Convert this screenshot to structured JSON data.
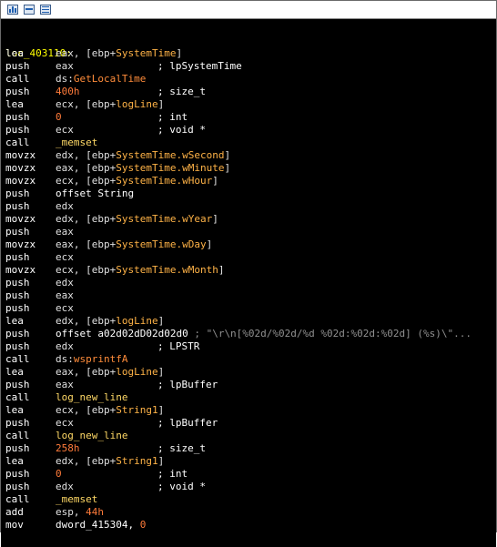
{
  "toolbar": {
    "buttons": [
      "graph-view-icon",
      "proximity-view-icon",
      "text-view-icon"
    ]
  },
  "code": {
    "label": "loc_403110:",
    "lines": [
      {
        "m": "lea",
        "t": [
          {
            "s": "eax, [ebp+",
            "c": "reg"
          },
          {
            "s": "SystemTime",
            "c": "var"
          },
          {
            "s": "]",
            "c": "reg"
          }
        ],
        "k": ""
      },
      {
        "m": "push",
        "t": [
          {
            "s": "eax",
            "c": "reg"
          }
        ],
        "k": "; lpSystemTime"
      },
      {
        "m": "call",
        "t": [
          {
            "s": "ds:",
            "c": "reg"
          },
          {
            "s": "GetLocalTime",
            "c": "fn"
          }
        ],
        "k": ""
      },
      {
        "m": "push",
        "t": [
          {
            "s": "400h",
            "c": "num"
          }
        ],
        "k": "; size_t"
      },
      {
        "m": "lea",
        "t": [
          {
            "s": "ecx, [ebp+",
            "c": "reg"
          },
          {
            "s": "logLine",
            "c": "var"
          },
          {
            "s": "]",
            "c": "reg"
          }
        ],
        "k": ""
      },
      {
        "m": "push",
        "t": [
          {
            "s": "0",
            "c": "num"
          }
        ],
        "k": "; int"
      },
      {
        "m": "push",
        "t": [
          {
            "s": "ecx",
            "c": "reg"
          }
        ],
        "k": "; void *"
      },
      {
        "m": "call",
        "t": [
          {
            "s": "_memset",
            "c": "sub"
          }
        ],
        "k": ""
      },
      {
        "m": "movzx",
        "t": [
          {
            "s": "edx, [ebp+",
            "c": "reg"
          },
          {
            "s": "SystemTime.wSecond",
            "c": "var"
          },
          {
            "s": "]",
            "c": "reg"
          }
        ],
        "k": ""
      },
      {
        "m": "movzx",
        "t": [
          {
            "s": "eax, [ebp+",
            "c": "reg"
          },
          {
            "s": "SystemTime.wMinute",
            "c": "var"
          },
          {
            "s": "]",
            "c": "reg"
          }
        ],
        "k": ""
      },
      {
        "m": "movzx",
        "t": [
          {
            "s": "ecx, [ebp+",
            "c": "reg"
          },
          {
            "s": "SystemTime.wHour",
            "c": "var"
          },
          {
            "s": "]",
            "c": "reg"
          }
        ],
        "k": ""
      },
      {
        "m": "push",
        "t": [
          {
            "s": "offset String",
            "c": "plain"
          }
        ],
        "k": ""
      },
      {
        "m": "push",
        "t": [
          {
            "s": "edx",
            "c": "reg"
          }
        ],
        "k": ""
      },
      {
        "m": "movzx",
        "t": [
          {
            "s": "edx, [ebp+",
            "c": "reg"
          },
          {
            "s": "SystemTime.wYear",
            "c": "var"
          },
          {
            "s": "]",
            "c": "reg"
          }
        ],
        "k": ""
      },
      {
        "m": "push",
        "t": [
          {
            "s": "eax",
            "c": "reg"
          }
        ],
        "k": ""
      },
      {
        "m": "movzx",
        "t": [
          {
            "s": "eax, [ebp+",
            "c": "reg"
          },
          {
            "s": "SystemTime.wDay",
            "c": "var"
          },
          {
            "s": "]",
            "c": "reg"
          }
        ],
        "k": ""
      },
      {
        "m": "push",
        "t": [
          {
            "s": "ecx",
            "c": "reg"
          }
        ],
        "k": ""
      },
      {
        "m": "movzx",
        "t": [
          {
            "s": "ecx, [ebp+",
            "c": "reg"
          },
          {
            "s": "SystemTime.wMonth",
            "c": "var"
          },
          {
            "s": "]",
            "c": "reg"
          }
        ],
        "k": ""
      },
      {
        "m": "push",
        "t": [
          {
            "s": "edx",
            "c": "reg"
          }
        ],
        "k": ""
      },
      {
        "m": "push",
        "t": [
          {
            "s": "eax",
            "c": "reg"
          }
        ],
        "k": ""
      },
      {
        "m": "push",
        "t": [
          {
            "s": "ecx",
            "c": "reg"
          }
        ],
        "k": ""
      },
      {
        "m": "lea",
        "t": [
          {
            "s": "edx, [ebp+",
            "c": "reg"
          },
          {
            "s": "logLine",
            "c": "var"
          },
          {
            "s": "]",
            "c": "reg"
          }
        ],
        "k": ""
      },
      {
        "m": "push",
        "t": [
          {
            "s": "offset a02d02dD02d02d0",
            "c": "plain"
          },
          {
            "s": " ; \"\\r\\n[%02d/%02d/%d %02d:%02d:%02d] (%s)\\\"...",
            "c": "strcmt"
          }
        ],
        "k": ""
      },
      {
        "m": "push",
        "t": [
          {
            "s": "edx",
            "c": "reg"
          }
        ],
        "k": "; LPSTR"
      },
      {
        "m": "call",
        "t": [
          {
            "s": "ds:",
            "c": "reg"
          },
          {
            "s": "wsprintfA",
            "c": "fn"
          }
        ],
        "k": ""
      },
      {
        "m": "lea",
        "t": [
          {
            "s": "eax, [ebp+",
            "c": "reg"
          },
          {
            "s": "logLine",
            "c": "var"
          },
          {
            "s": "]",
            "c": "reg"
          }
        ],
        "k": ""
      },
      {
        "m": "push",
        "t": [
          {
            "s": "eax",
            "c": "reg"
          }
        ],
        "k": "; lpBuffer"
      },
      {
        "m": "call",
        "t": [
          {
            "s": "log_new_line",
            "c": "sub"
          }
        ],
        "k": ""
      },
      {
        "m": "lea",
        "t": [
          {
            "s": "ecx, [ebp+",
            "c": "reg"
          },
          {
            "s": "String1",
            "c": "var"
          },
          {
            "s": "]",
            "c": "reg"
          }
        ],
        "k": ""
      },
      {
        "m": "push",
        "t": [
          {
            "s": "ecx",
            "c": "reg"
          }
        ],
        "k": "; lpBuffer"
      },
      {
        "m": "call",
        "t": [
          {
            "s": "log_new_line",
            "c": "sub"
          }
        ],
        "k": ""
      },
      {
        "m": "push",
        "t": [
          {
            "s": "258h",
            "c": "num"
          }
        ],
        "k": "; size_t"
      },
      {
        "m": "lea",
        "t": [
          {
            "s": "edx, [ebp+",
            "c": "reg"
          },
          {
            "s": "String1",
            "c": "var"
          },
          {
            "s": "]",
            "c": "reg"
          }
        ],
        "k": ""
      },
      {
        "m": "push",
        "t": [
          {
            "s": "0",
            "c": "num"
          }
        ],
        "k": "; int"
      },
      {
        "m": "push",
        "t": [
          {
            "s": "edx",
            "c": "reg"
          }
        ],
        "k": "; void *"
      },
      {
        "m": "call",
        "t": [
          {
            "s": "_memset",
            "c": "sub"
          }
        ],
        "k": ""
      },
      {
        "m": "add",
        "t": [
          {
            "s": "esp, ",
            "c": "reg"
          },
          {
            "s": "44h",
            "c": "num"
          }
        ],
        "k": ""
      },
      {
        "m": "mov",
        "t": [
          {
            "s": "dword_415304, ",
            "c": "plain"
          },
          {
            "s": "0",
            "c": "num"
          }
        ],
        "k": ""
      }
    ]
  }
}
